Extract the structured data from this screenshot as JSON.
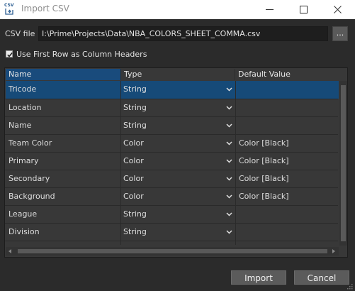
{
  "window": {
    "title": "Import CSV",
    "app_icon": "csv-import-icon",
    "controls": [
      "minimize-icon",
      "maximize-icon",
      "close-icon"
    ]
  },
  "csv_file": {
    "label": "CSV file",
    "path": "I:\\Prime\\Projects\\Data\\NBA_COLORS_SHEET_COMMA.csv",
    "browse_label": "..."
  },
  "header_option": {
    "label": "Use First Row as Column Headers",
    "checked": true
  },
  "table": {
    "columns": [
      "Name",
      "Type",
      "Default Value"
    ],
    "rows": [
      {
        "name": "Tricode",
        "type": "String",
        "default": ""
      },
      {
        "name": "Location",
        "type": "String",
        "default": ""
      },
      {
        "name": "Name",
        "type": "String",
        "default": ""
      },
      {
        "name": "Team Color",
        "type": "Color",
        "default": "Color [Black]"
      },
      {
        "name": "Primary",
        "type": "Color",
        "default": "Color [Black]"
      },
      {
        "name": "Secondary",
        "type": "Color",
        "default": "Color [Black]"
      },
      {
        "name": "Background",
        "type": "Color",
        "default": "Color [Black]"
      },
      {
        "name": "League",
        "type": "String",
        "default": ""
      },
      {
        "name": "Division",
        "type": "String",
        "default": ""
      }
    ],
    "selected_row": 0
  },
  "buttons": {
    "import": "Import",
    "cancel": "Cancel"
  },
  "colors": {
    "background": "#2b2b2b",
    "selection": "#164a78",
    "header_selected": "#194b7c"
  }
}
